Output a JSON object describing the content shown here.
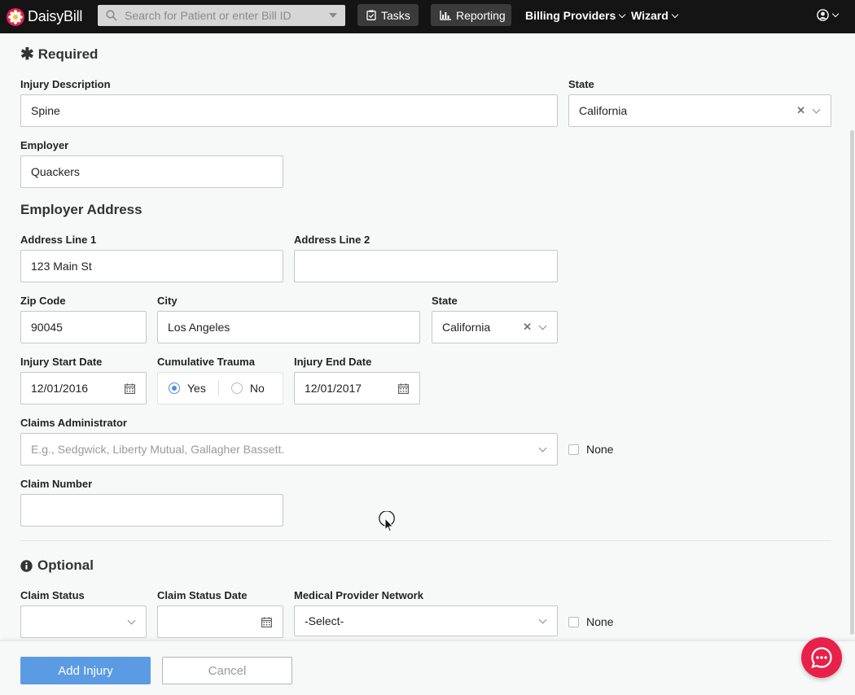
{
  "nav": {
    "brand": "DaisyBill",
    "search_placeholder": "Search for Patient or enter Bill ID",
    "tasks": "Tasks",
    "reporting": "Reporting",
    "billing_providers": "Billing Providers",
    "wizard": "Wizard"
  },
  "required": {
    "heading": "Required",
    "injury_description": {
      "label": "Injury Description",
      "value": "Spine"
    },
    "state": {
      "label": "State",
      "value": "California"
    },
    "employer": {
      "label": "Employer",
      "value": "Quackers"
    }
  },
  "employer_address": {
    "heading": "Employer Address",
    "line1": {
      "label": "Address Line 1",
      "value": "123 Main St"
    },
    "line2": {
      "label": "Address Line 2",
      "value": ""
    },
    "zip": {
      "label": "Zip Code",
      "value": "90045"
    },
    "city": {
      "label": "City",
      "value": "Los Angeles"
    },
    "state": {
      "label": "State",
      "value": "California"
    }
  },
  "injury_dates": {
    "start": {
      "label": "Injury Start Date",
      "value": "12/01/2016"
    },
    "trauma": {
      "label": "Cumulative Trauma",
      "yes": "Yes",
      "no": "No",
      "selected": "Yes"
    },
    "end": {
      "label": "Injury End Date",
      "value": "12/01/2017"
    }
  },
  "claims_admin": {
    "label": "Claims Administrator",
    "placeholder": "E.g., Sedgwick, Liberty Mutual, Gallagher Bassett.",
    "none": "None"
  },
  "claim_number": {
    "label": "Claim Number",
    "value": ""
  },
  "optional": {
    "heading": "Optional",
    "claim_status": {
      "label": "Claim Status",
      "value": ""
    },
    "claim_status_date": {
      "label": "Claim Status Date",
      "value": ""
    },
    "mpn": {
      "label": "Medical Provider Network",
      "value": "-Select-"
    },
    "none": "None"
  },
  "footer": {
    "add": "Add Injury",
    "cancel": "Cancel"
  },
  "colors": {
    "primary": "#5b9be3",
    "nav_bg": "#141414",
    "chat": "#e8214a",
    "radio": "#4a90e2"
  }
}
